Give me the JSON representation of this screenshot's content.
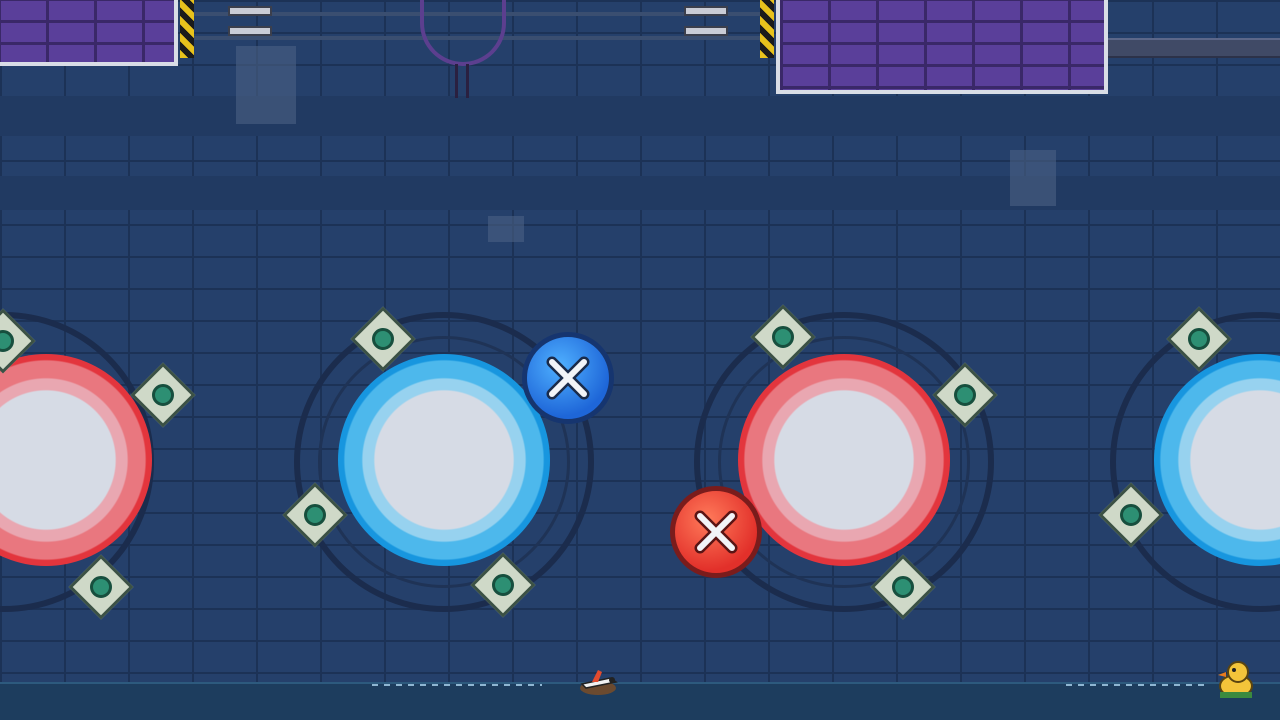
{
  "scene": {
    "type": "platformer-level",
    "theme": "blue-brick-dungeon",
    "colors": {
      "background": "#25406b",
      "brick_line": "#1c3256",
      "red_portal": "#e3353d",
      "blue_portal": "#1796df",
      "wall_purple": "#5a3f9a"
    }
  },
  "portals": [
    {
      "name": "portal-red-1",
      "color": "red"
    },
    {
      "name": "portal-blue-1",
      "color": "blue"
    },
    {
      "name": "portal-red-2",
      "color": "red"
    },
    {
      "name": "portal-blue-2",
      "color": "blue"
    }
  ],
  "buttons": [
    {
      "name": "blue-cross-button",
      "color": "blue",
      "icon": "cross-icon"
    },
    {
      "name": "red-cross-button",
      "color": "red",
      "icon": "cross-icon"
    }
  ],
  "characters": [
    {
      "name": "player-character",
      "icon": "plane-icon"
    },
    {
      "name": "duck-character",
      "icon": "duck-icon"
    }
  ]
}
